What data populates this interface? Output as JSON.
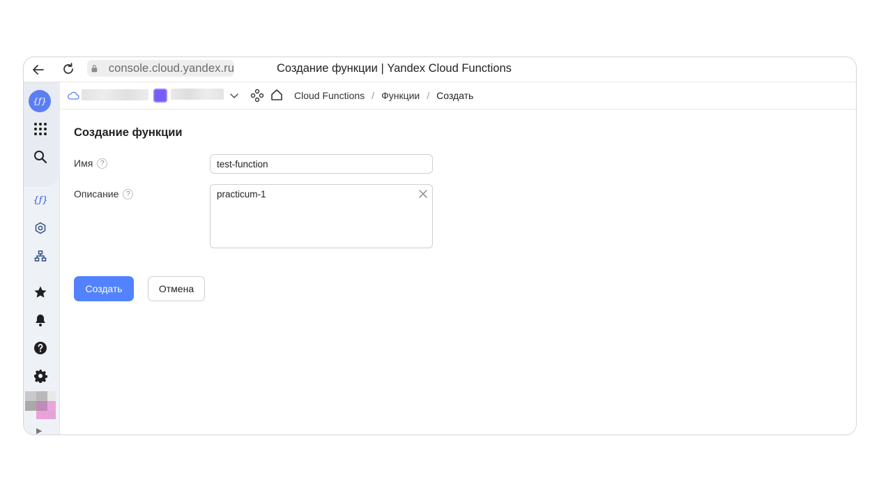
{
  "browser": {
    "url": "console.cloud.yandex.ru",
    "tab_title": "Создание функции | Yandex Cloud Functions"
  },
  "sidebar": {
    "logo_text": "{ƒ}",
    "items": [
      {
        "icon": "apps-grid-icon"
      },
      {
        "icon": "search-icon"
      },
      {
        "icon": "functions-icon"
      },
      {
        "icon": "service-gear-icon"
      },
      {
        "icon": "network-icon"
      },
      {
        "icon": "star-icon"
      },
      {
        "icon": "bell-icon"
      },
      {
        "icon": "help-icon"
      },
      {
        "icon": "settings-icon"
      }
    ],
    "expand_glyph": "▶"
  },
  "topnav": {
    "breadcrumbs": [
      "Cloud Functions",
      "Функции",
      "Создать"
    ],
    "separator": "/"
  },
  "form": {
    "title": "Создание функции",
    "name_label": "Имя",
    "name_value": "test-function",
    "description_label": "Описание",
    "description_value": "practicum-1",
    "help_glyph": "?",
    "submit_label": "Создать",
    "cancel_label": "Отмена"
  },
  "colors": {
    "accent": "#5282ff",
    "folder": "#7a5cf5",
    "sidebar_bg": "#eef1f6"
  }
}
